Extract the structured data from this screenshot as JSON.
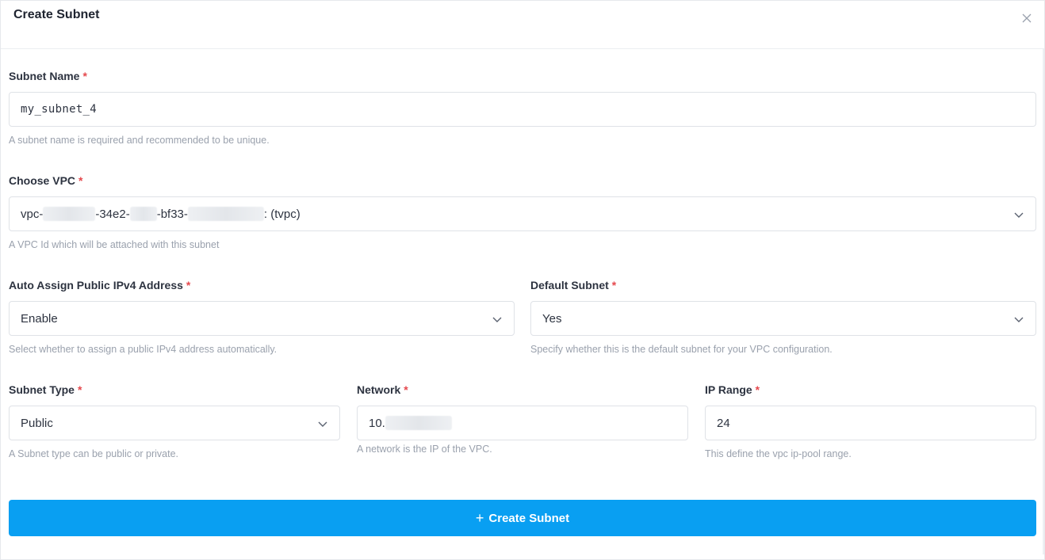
{
  "modal": {
    "title": "Create Subnet"
  },
  "fields": {
    "subnet_name": {
      "label": "Subnet Name",
      "required_mark": "*",
      "value": "my_subnet_4",
      "help": "A subnet name is required and recommended to be unique."
    },
    "vpc": {
      "label": "Choose VPC",
      "required_mark": "*",
      "value_parts": [
        "vpc-",
        "-34e2-",
        "-bf33-",
        ": (tvpc)"
      ],
      "help": "A VPC Id which will be attached with this subnet"
    },
    "auto_assign": {
      "label": "Auto Assign Public IPv4 Address",
      "required_mark": "*",
      "value": "Enable",
      "help": "Select whether to assign a public IPv4 address automatically."
    },
    "default_subnet": {
      "label": "Default Subnet",
      "required_mark": "*",
      "value": "Yes",
      "help": "Specify whether this is the default subnet for your VPC configuration."
    },
    "subnet_type": {
      "label": "Subnet Type",
      "required_mark": "*",
      "value": "Public",
      "help": "A Subnet type can be public or private."
    },
    "network": {
      "label": "Network",
      "required_mark": "*",
      "value": "10.",
      "help": "A network is the IP of the VPC."
    },
    "ip_range": {
      "label": "IP Range",
      "required_mark": "*",
      "value": "24",
      "help": "This define the vpc ip-pool range."
    }
  },
  "submit": {
    "icon": "plus-icon",
    "label": "Create Subnet"
  },
  "colors": {
    "accent": "#099ff2",
    "required": "#e5484d"
  }
}
